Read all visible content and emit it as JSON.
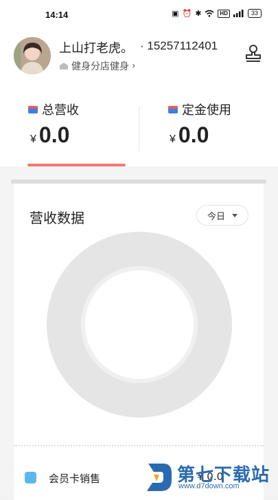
{
  "status_bar": {
    "time": "14:14",
    "battery": "33",
    "hd": "HD"
  },
  "profile": {
    "name": "上山打老虎。",
    "phone": "· 15257112401",
    "store": "健身分店健身"
  },
  "tabs": [
    {
      "title": "总营收",
      "currency": "¥",
      "amount": "0.0",
      "active": true
    },
    {
      "title": "定金使用",
      "currency": "¥",
      "amount": "0.0",
      "active": false
    }
  ],
  "revenue_card": {
    "title": "营收数据",
    "period": "今日",
    "legend": [
      {
        "label": "会员卡销售",
        "value": "¥ 0.0",
        "color": "#5bb8ef"
      }
    ]
  },
  "chart_data": {
    "type": "pie",
    "title": "",
    "categories": [
      "会员卡销售"
    ],
    "values": [
      0.0
    ],
    "donut": true
  },
  "watermark": {
    "brand": "第七下载站",
    "url": "www.d7down.com"
  },
  "colors": {
    "accent": "#f07a6e",
    "legend_blue": "#5bb8ef",
    "wallet_red": "#e85a5a",
    "wallet_blue": "#3d7fe0"
  }
}
